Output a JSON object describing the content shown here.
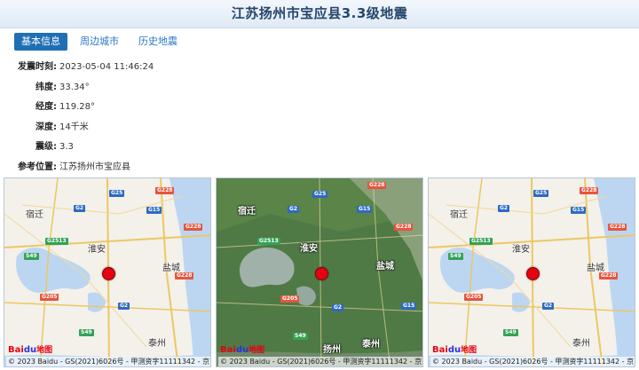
{
  "page": {
    "title": "江苏扬州市宝应县3.3级地震"
  },
  "tabs": [
    {
      "label": "基本信息",
      "active": true
    },
    {
      "label": "周边城市",
      "active": false
    },
    {
      "label": "历史地震",
      "active": false
    }
  ],
  "info": [
    {
      "label": "发震时刻:",
      "value": "2023-05-04 11:46:24"
    },
    {
      "label": "纬度:",
      "value": "33.34°"
    },
    {
      "label": "经度:",
      "value": "119.28°"
    },
    {
      "label": "深度:",
      "value": "14千米"
    },
    {
      "label": "震级:",
      "value": "3.3"
    },
    {
      "label": "参考位置:",
      "value": "江苏扬州市宝应县"
    }
  ],
  "maps": {
    "logo_bai": "Bai",
    "logo_du": "du",
    "logo_ditu": "地图",
    "copyright": "© 2023 Baidu - GS(2021)6026号 - 甲测资字11111342 - 京",
    "cities": {
      "suqian": "宿迁",
      "huaian": "淮安",
      "yancheng": "盐城",
      "taizhou": "泰州",
      "yangzhou": "扬州"
    },
    "roads": {
      "g25": "G25",
      "g228": "G228",
      "g2": "G2",
      "g15": "G15",
      "g2513": "G2513",
      "s49": "S49",
      "g205": "G205"
    },
    "colors": {
      "marker": "#e60012",
      "water": "#bcd6f2",
      "land": "#f3f1ea",
      "satellite": "#4f7a45"
    }
  }
}
